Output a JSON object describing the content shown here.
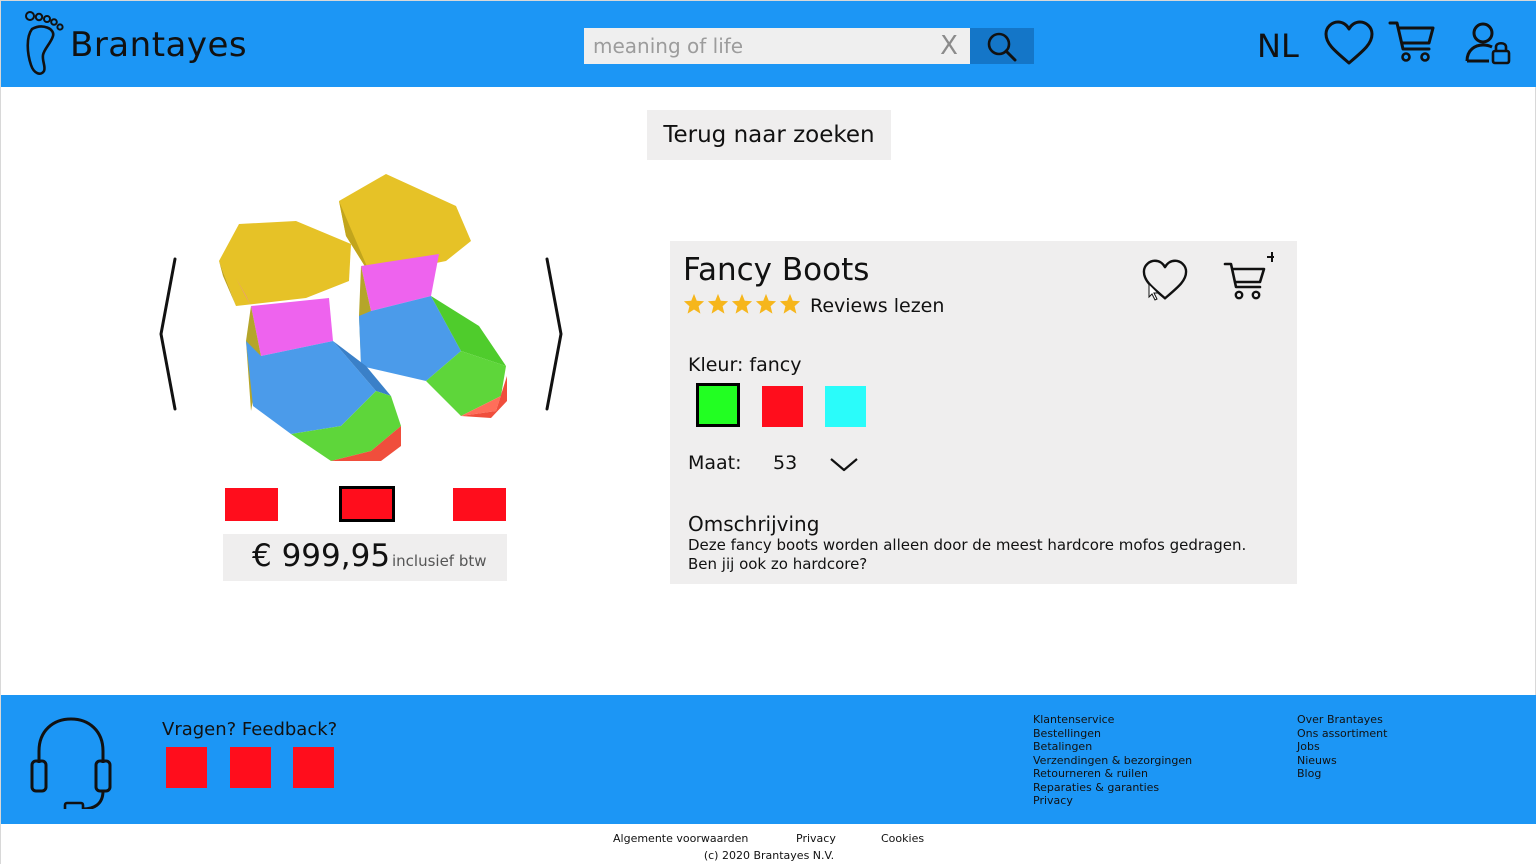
{
  "header": {
    "brand": "Brantayes",
    "search_value": "meaning of life",
    "clear_label": "X",
    "language": "NL",
    "icons": [
      "logo-foot-icon",
      "search-icon",
      "heart-icon",
      "cart-icon",
      "account-lock-icon"
    ]
  },
  "nav": {
    "back_label": "Terug naar zoeken"
  },
  "gallery": {
    "price": "€ 999,95",
    "vat_note": "inclusief btw",
    "thumbnail_count": 3,
    "selected_thumbnail": 2
  },
  "product": {
    "title": "Fancy Boots",
    "rating": 5,
    "rating_max": 5,
    "reviews_label": "Reviews lezen",
    "color_label": "Kleur: fancy",
    "swatches": [
      "#22ff22",
      "#ff0d1c",
      "#2afcfa"
    ],
    "selected_swatch": 0,
    "size_label": "Maat:",
    "size_value": "53",
    "description_title": "Omschrijving",
    "description": "Deze fancy boots worden alleen door de meest hardcore mofos gedragen. Ben jij ook zo hardcore?"
  },
  "footer": {
    "feedback_title": "Vragen? Feedback?",
    "col1": [
      "Klantenservice",
      "Bestellingen",
      "Betalingen",
      "Verzendingen & bezorgingen",
      "Retourneren & ruilen",
      "Reparaties & garanties",
      "Privacy"
    ],
    "col2": [
      "Over Brantayes",
      "Ons assortiment",
      "Jobs",
      "Nieuws",
      "Blog"
    ],
    "bottom_links": [
      "Algemente voorwaarden",
      "Privacy",
      "Cookies"
    ],
    "copyright": "(c) 2020 Brantayes N.V."
  },
  "colors": {
    "brand_blue": "#1c96f5",
    "search_button": "#1476c8",
    "panel_grey": "#efeeee",
    "placeholder_red": "#ff0d1c",
    "star_yellow": "#f6b61c"
  }
}
